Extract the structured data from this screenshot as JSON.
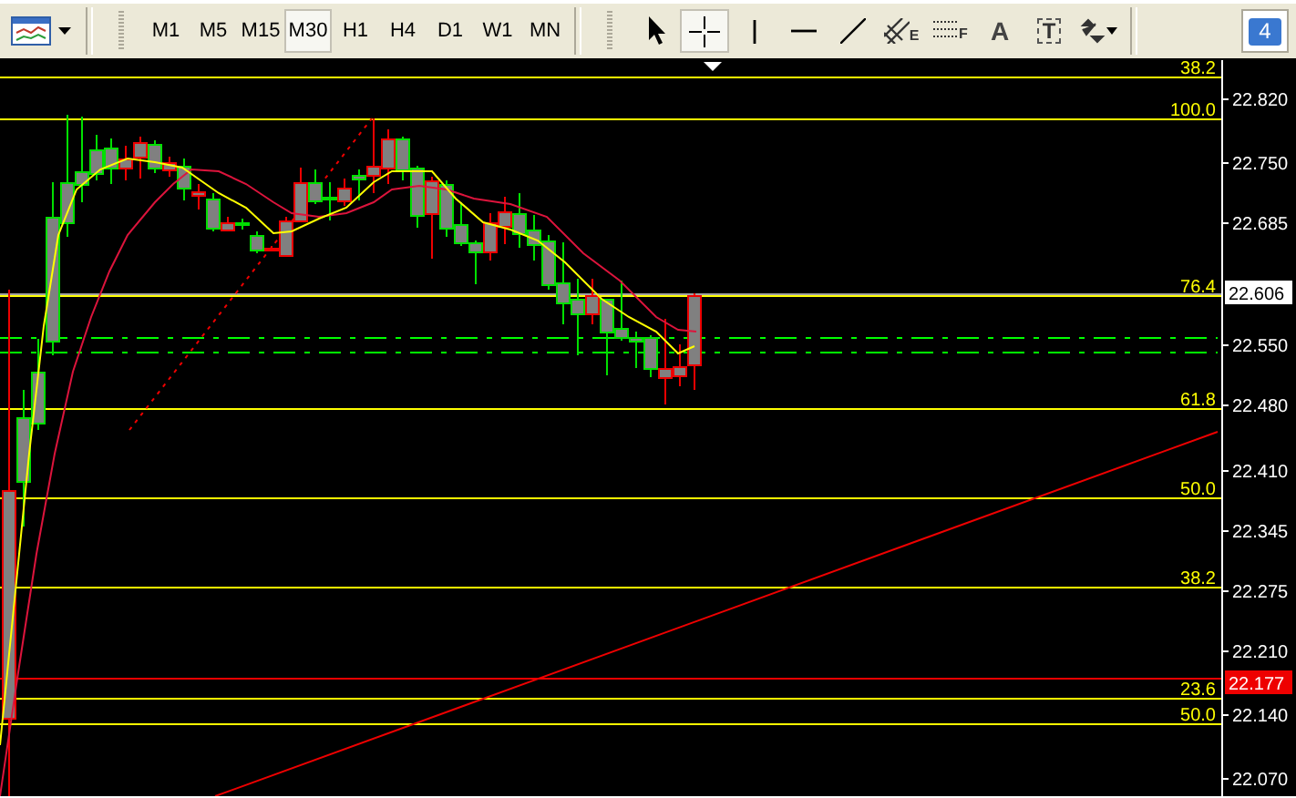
{
  "toolbar": {
    "chart_menu": {
      "kind": "chart"
    },
    "timeframes": [
      {
        "label": "M1",
        "selected": false
      },
      {
        "label": "M5",
        "selected": false
      },
      {
        "label": "M15",
        "selected": false
      },
      {
        "label": "M30",
        "selected": true
      },
      {
        "label": "H1",
        "selected": false
      },
      {
        "label": "H4",
        "selected": false
      },
      {
        "label": "D1",
        "selected": false
      },
      {
        "label": "W1",
        "selected": false
      },
      {
        "label": "MN",
        "selected": false
      }
    ],
    "tools": [
      {
        "kind": "cursor",
        "selected": false
      },
      {
        "kind": "crosshair",
        "selected": true
      },
      {
        "kind": "vline",
        "selected": false
      },
      {
        "kind": "hline",
        "selected": false
      },
      {
        "kind": "trendline",
        "selected": false
      },
      {
        "kind": "channel",
        "letter": "E",
        "selected": false
      },
      {
        "kind": "fibo",
        "letter": "F",
        "selected": false
      },
      {
        "kind": "text",
        "letter": "A",
        "selected": false
      },
      {
        "kind": "label",
        "letter": "T",
        "selected": false
      },
      {
        "kind": "arrows",
        "selected": false
      }
    ],
    "notifications": {
      "count": "4"
    }
  },
  "chart": {
    "fib_levels": [
      {
        "label": "38.2"
      },
      {
        "label": "100.0"
      },
      {
        "label": "76.4"
      },
      {
        "label": "61.8"
      },
      {
        "label": "50.0"
      },
      {
        "label": "38.2"
      },
      {
        "label": "23.6"
      },
      {
        "label": "50.0"
      }
    ],
    "price_axis": [
      "22.820",
      "22.750",
      "22.685",
      "22.550",
      "22.480",
      "22.410",
      "22.345",
      "22.275",
      "22.210",
      "22.140",
      "22.070"
    ],
    "bid_price": "22.606",
    "line_price": "22.177"
  }
}
